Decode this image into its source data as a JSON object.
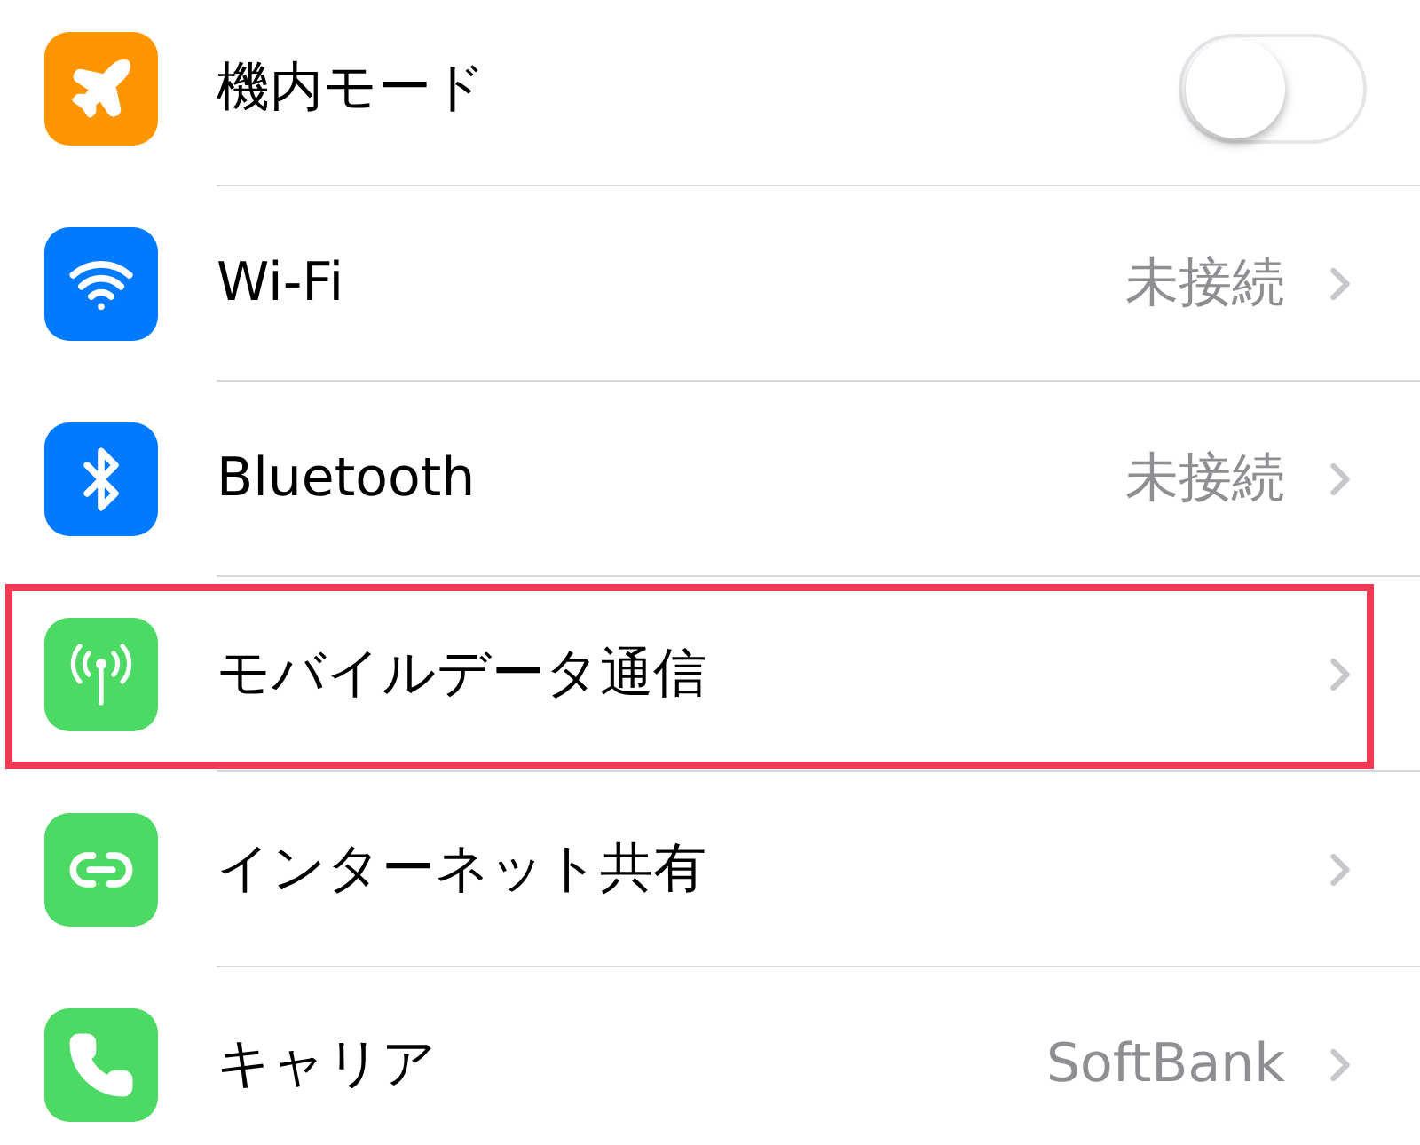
{
  "rows": [
    {
      "kind": "toggle",
      "color": "#ff9500",
      "label": "機内モード",
      "on": false,
      "highlighted": false
    },
    {
      "kind": "link",
      "color": "#007aff",
      "label": "Wi-Fi",
      "value": "未接続",
      "highlighted": false
    },
    {
      "kind": "link",
      "color": "#007aff",
      "label": "Bluetooth",
      "value": "未接続",
      "highlighted": false
    },
    {
      "kind": "link",
      "color": "#4cd964",
      "label": "モバイルデータ通信",
      "highlighted": true
    },
    {
      "kind": "link",
      "color": "#4cd964",
      "label": "インターネット共有",
      "highlighted": false
    },
    {
      "kind": "link",
      "color": "#4cd964",
      "label": "キャリア",
      "value": "SoftBank",
      "highlighted": false
    }
  ]
}
